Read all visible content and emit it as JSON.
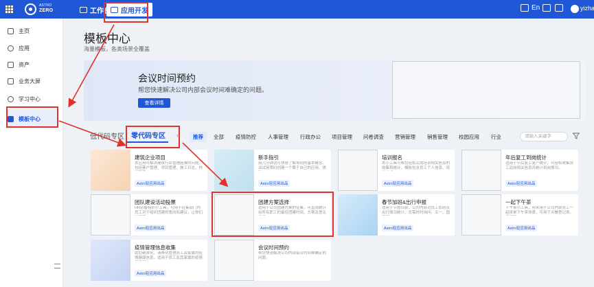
{
  "topbar": {
    "logo_line1": "ASTRO",
    "logo_line2": "ZERO",
    "tabs": [
      {
        "label": "工作台"
      },
      {
        "label": "应用开发"
      }
    ],
    "lang": "En",
    "username": "yizhang"
  },
  "sidebar": {
    "items": [
      {
        "label": "主页",
        "icon": "home-icon"
      },
      {
        "label": "应用",
        "icon": "app-icon"
      },
      {
        "label": "资产",
        "icon": "asset-icon"
      },
      {
        "label": "业务大屏",
        "icon": "dashboard-icon"
      },
      {
        "label": "学习中心",
        "icon": "learn-icon"
      },
      {
        "label": "模板中心",
        "icon": "template-icon"
      }
    ]
  },
  "main": {
    "title": "模板中心",
    "subtitle": "海量模板，各类场景全覆盖",
    "banner": {
      "title": "会议时间预约",
      "desc": "帮您快速解决公司内部会议时间难确定的问题。",
      "button": "查看详情"
    },
    "section_tabs": [
      "低代码专区",
      "零代码专区"
    ],
    "categories": [
      "推荐",
      "全部",
      "疫情防控",
      "人事管理",
      "行政办公",
      "项目管理",
      "问卷调查",
      "营销管理",
      "销售管理",
      "校园应用",
      "行业"
    ],
    "search_placeholder": "请输入关键字",
    "cards": [
      {
        "title": "建筑企业项目",
        "desc": "本应用可解决建筑行业管理困难的问题，包括客户管理、项目管理、施工日志、材料管理…",
        "tag": "Astro轻应用出品"
      },
      {
        "title": "新手指引",
        "desc": "用几分钟就可快速了解零码的基本概念、试试用零码创建一个属于自己的应用、体验…",
        "tag": "Astro轻应用出品"
      },
      {
        "title": "培训报名",
        "desc": "本小工具可帮您轻松完成培训相关信息的收集和统计，模板包含员工个人信息、培训方式…",
        "tag": "Astro轻应用出品"
      },
      {
        "title": "年后复工到岗统计",
        "desc": "适用于节后复工复产统计，可轻松收集员工返岗相关信息并统计到岗情况。",
        "tag": "Astro轻应用出品"
      },
      {
        "title": "团队建设活动投票",
        "desc": "HR必备组织小工具，可用于征集部门内员工对于组织团建的意向和建议，让你们的团建…",
        "tag": "Astro轻应用出品"
      },
      {
        "title": "团建方案选择",
        "desc": "适用于公司团建方案的征集，可直观统计出所有职工的最佳团建时间、方案及意见反馈…",
        "tag": "Astro轻应用出品"
      },
      {
        "title": "春节加班&出行申报",
        "desc": "适用于节假日前，公司内部对员工加班及出行情况统计，无需时时询问，五一、国庆等…",
        "tag": "Astro轻应用出品"
      },
      {
        "title": "一起下午茶",
        "desc": "下午茶小工具，用来用于公司内部员工一起拼单下午茶场景，可用于点餐登记表、偏好等…",
        "tag": "Astro轻应用出品"
      },
      {
        "title": "疫情管理信息收集",
        "desc": "助您精准化、清晰化管理员工及家属的疫情健康信息，适用于员工及其家属的疫情每日打卡…",
        "tag": "Astro轻应用出品"
      },
      {
        "title": "会议时间预约",
        "desc": "帮您快速解决公司内部会议时间难确定的问题。",
        "tag": ""
      }
    ]
  },
  "colors": {
    "brand": "#1f57d6",
    "highlight": "#e0312a"
  }
}
